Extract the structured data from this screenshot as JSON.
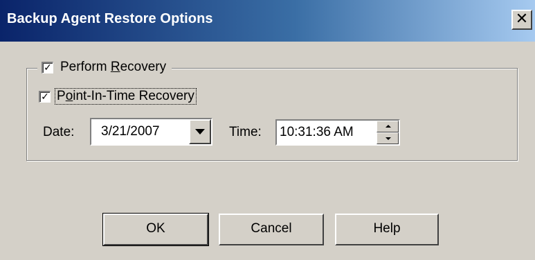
{
  "window": {
    "title": "Backup Agent Restore Options",
    "close_symbol": "✕",
    "colors": {
      "titlebar_start": "#0a246a",
      "titlebar_end": "#a6caf0",
      "face": "#d4d0c8"
    }
  },
  "recovery_group": {
    "perform_recovery": {
      "label_before": "Perform ",
      "label_mnemonic": "R",
      "label_after": "ecovery",
      "checked": true,
      "check_mark": "✓"
    },
    "point_in_time": {
      "label_before": "P",
      "label_mnemonic": "o",
      "label_after": "int-In-Time Recovery",
      "checked": true,
      "check_mark": "✓"
    },
    "date": {
      "label": "Date:",
      "value": "3/21/2007",
      "dropdown_icon": "chevron-down-icon"
    },
    "time": {
      "label": "Time:",
      "value": "10:31:36 AM",
      "spin_icons": [
        "spin-up-icon",
        "spin-down-icon"
      ]
    }
  },
  "buttons": {
    "ok": "OK",
    "cancel": "Cancel",
    "help": "Help"
  }
}
